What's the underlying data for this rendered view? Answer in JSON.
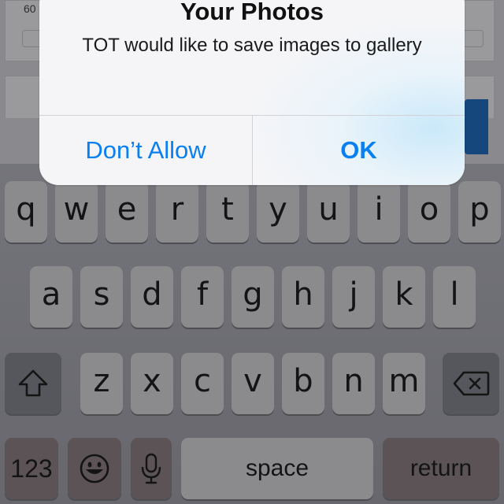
{
  "background_app": {
    "visible_number": "60",
    "accent_button_color": "#16477c"
  },
  "alert": {
    "title": "Your Photos",
    "message": "TOT would like to save images to gallery",
    "buttons": {
      "dont_allow": "Don’t Allow",
      "ok": "OK"
    },
    "button_color": "#0a7ff0"
  },
  "keyboard": {
    "row1": [
      "q",
      "w",
      "e",
      "r",
      "t",
      "y",
      "u",
      "i",
      "o",
      "p"
    ],
    "row2": [
      "a",
      "s",
      "d",
      "f",
      "g",
      "h",
      "j",
      "k",
      "l"
    ],
    "row3": [
      "z",
      "x",
      "c",
      "v",
      "b",
      "n",
      "m"
    ],
    "shift_icon": "shift-icon",
    "delete_icon": "backspace-icon",
    "numbers_label": "123",
    "emoji_icon": "emoji-icon",
    "mic_icon": "microphone-icon",
    "space_label": "space",
    "return_label": "return"
  }
}
